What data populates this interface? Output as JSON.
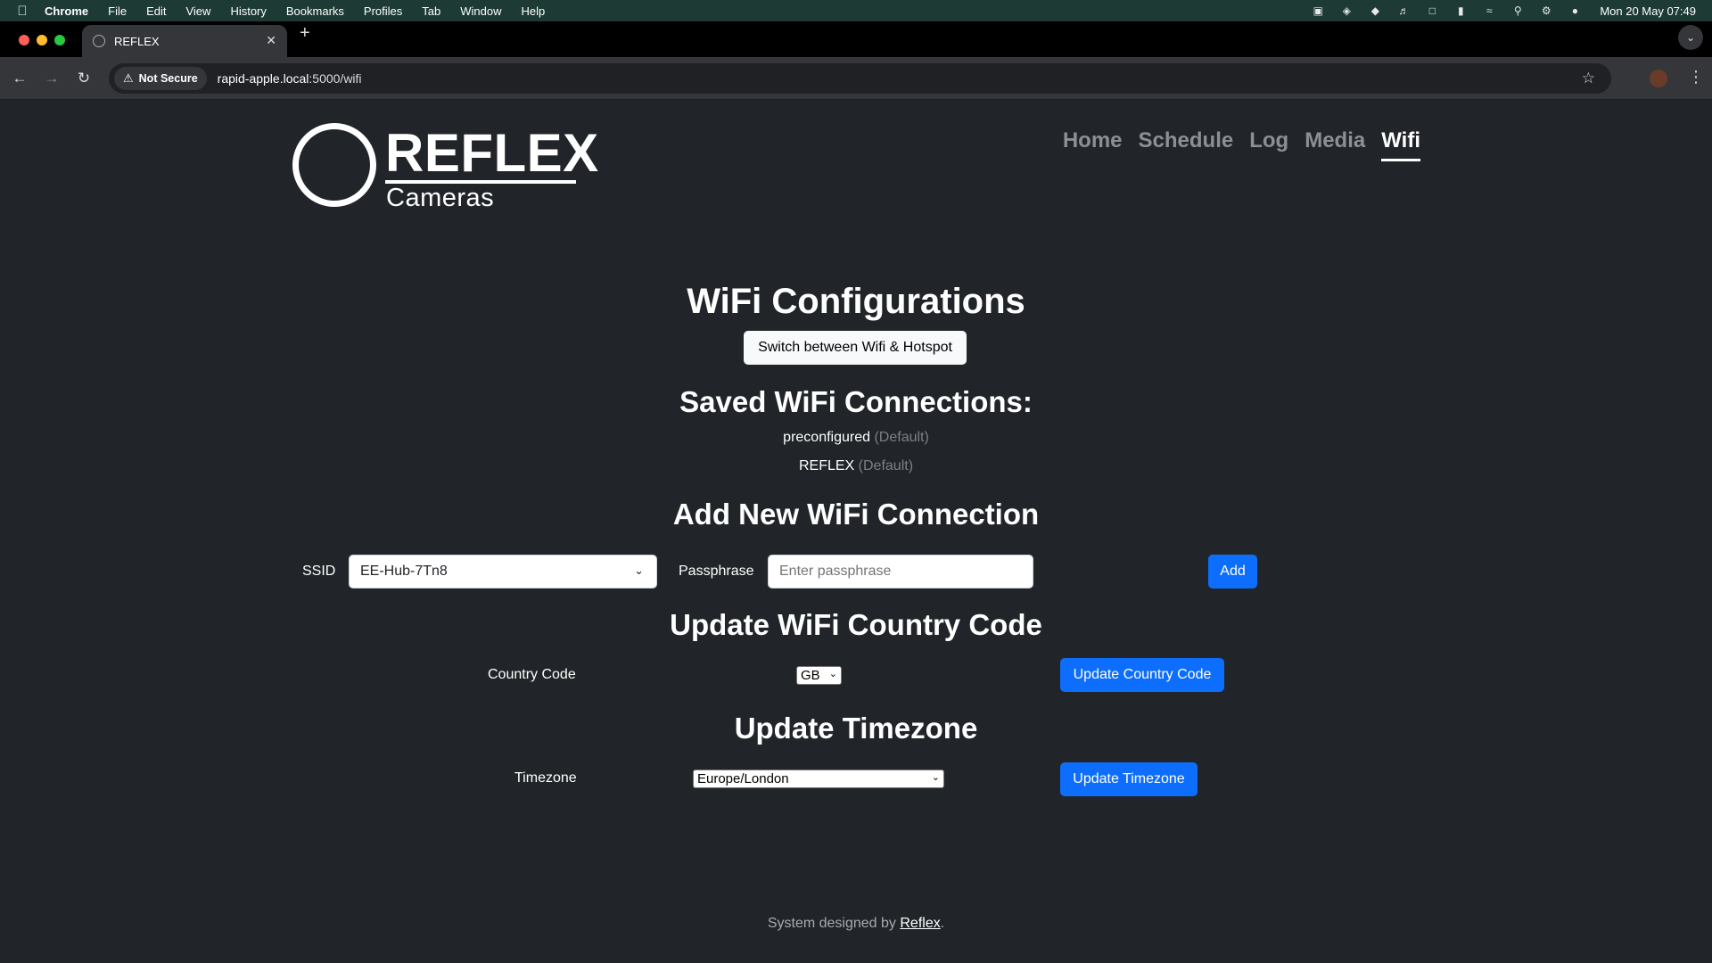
{
  "menubar": {
    "app": "Chrome",
    "items": [
      "File",
      "Edit",
      "View",
      "History",
      "Bookmarks",
      "Profiles",
      "Tab",
      "Window",
      "Help"
    ],
    "clock": "Mon 20 May  07:49"
  },
  "browser": {
    "tab_title": "REFLEX",
    "security_chip": "Not Secure",
    "url_host": "rapid-apple.local",
    "url_path": ":5000/wifi"
  },
  "logo": {
    "word": "REFLEX",
    "sub": "Cameras"
  },
  "nav": {
    "home": "Home",
    "schedule": "Schedule",
    "log": "Log",
    "media": "Media",
    "wifi": "Wifi",
    "active": "Wifi"
  },
  "main": {
    "title": "WiFi Configurations",
    "switch_button": "Switch between Wifi & Hotspot",
    "saved_heading": "Saved WiFi Connections:",
    "saved": [
      {
        "name": "preconfigured",
        "tag": "(Default)"
      },
      {
        "name": "REFLEX",
        "tag": "(Default)"
      }
    ],
    "add_heading": "Add New WiFi Connection",
    "ssid_label": "SSID",
    "ssid_value": "EE-Hub-7Tn8",
    "passphrase_label": "Passphrase",
    "passphrase_placeholder": "Enter passphrase",
    "add_button": "Add",
    "country_heading": "Update WiFi Country Code",
    "country_label": "Country Code",
    "country_value": "GB",
    "country_button": "Update Country Code",
    "tz_heading": "Update Timezone",
    "tz_label": "Timezone",
    "tz_value": "Europe/London",
    "tz_button": "Update Timezone"
  },
  "footer": {
    "prefix": "System designed by ",
    "link": "Reflex",
    "suffix": "."
  }
}
